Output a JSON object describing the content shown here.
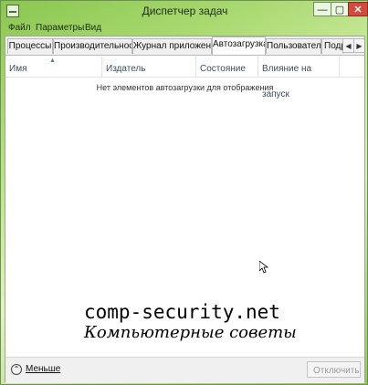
{
  "window": {
    "title": "Диспетчер задач"
  },
  "controls": {
    "minimize_glyph": "—",
    "maximize_glyph": "▢",
    "close_glyph": "✕"
  },
  "menu": [
    "Файл",
    "Параметры",
    "Вид"
  ],
  "tabs": [
    "Процессы",
    "Производительность",
    "Журнал приложений",
    "Автозагрузка",
    "Пользователи",
    "Подр"
  ],
  "tab_scroll": {
    "left": "◀",
    "right": "▶"
  },
  "active_tab": "Автозагрузка",
  "columns": [
    "Имя",
    "Издатель",
    "Состояние",
    "Влияние на запуск"
  ],
  "sort_indicator": "▲",
  "empty_message": "Нет элементов автозагрузки для отображения",
  "watermark": {
    "line1": "comp-security.net",
    "line2": "Компьютерные советы"
  },
  "footer": {
    "fewer_label": "Меньше",
    "fewer_icon": "chevron-up-icon",
    "fewer_glyph": "⌃",
    "disable_label": "Отключить"
  },
  "colors": {
    "accent": "#4a78b8",
    "close_button": "#d24b3c",
    "background": "#8cc850"
  }
}
